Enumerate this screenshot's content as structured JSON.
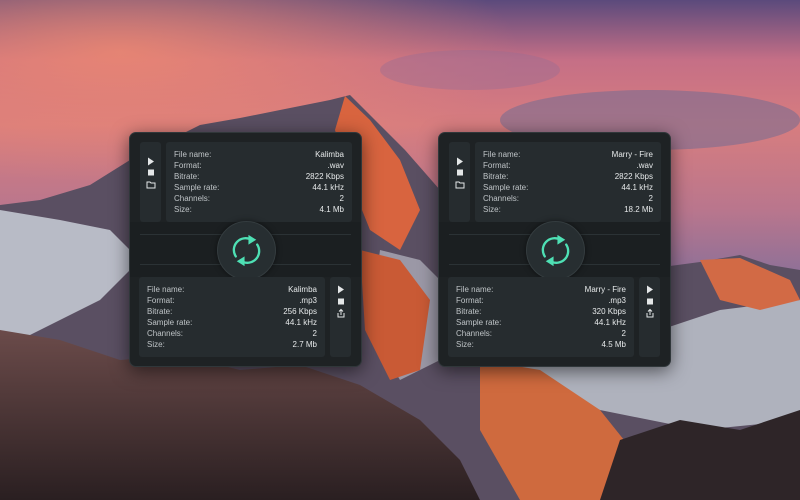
{
  "background": {
    "image": "mountain-sunset-wallpaper"
  },
  "colors": {
    "accent": "#4ee0b4",
    "panel": "#1e2224",
    "card": "#262c2f"
  },
  "icons": {
    "play": "play-icon",
    "stop": "stop-icon",
    "folder": "folder-icon",
    "share": "share-icon",
    "convert": "convert-arrows-icon"
  },
  "labels": {
    "file_name": "File name:",
    "format": "Format:",
    "bitrate": "Bitrate:",
    "sample_rate": "Sample rate:",
    "channels": "Channels:",
    "size": "Size:"
  },
  "converters": [
    {
      "source": {
        "file_name": "Kalimba",
        "format": ".wav",
        "bitrate": "2822 Kbps",
        "sample_rate": "44.1 kHz",
        "channels": "2",
        "size": "4.1 Mb"
      },
      "output": {
        "file_name": "Kalimba",
        "format": ".mp3",
        "bitrate": "256 Kbps",
        "sample_rate": "44.1 kHz",
        "channels": "2",
        "size": "2.7 Mb"
      }
    },
    {
      "source": {
        "file_name": "Marry - Fire",
        "format": ".wav",
        "bitrate": "2822 Kbps",
        "sample_rate": "44.1 kHz",
        "channels": "2",
        "size": "18.2 Mb"
      },
      "output": {
        "file_name": "Marry - Fire",
        "format": ".mp3",
        "bitrate": "320 Kbps",
        "sample_rate": "44.1 kHz",
        "channels": "2",
        "size": "4.5 Mb"
      }
    }
  ]
}
